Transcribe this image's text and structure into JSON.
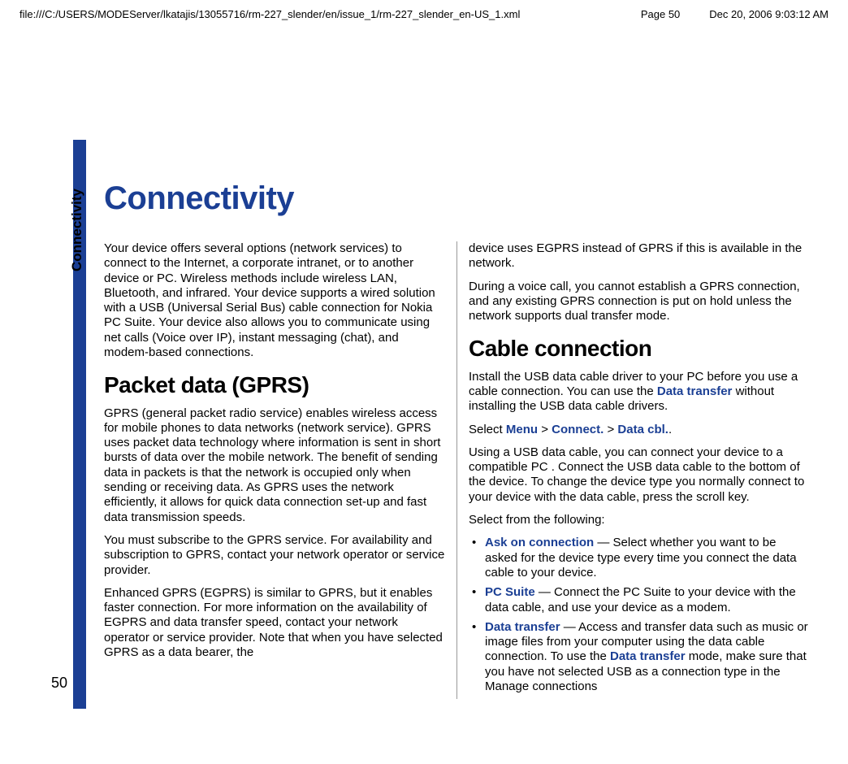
{
  "header": {
    "path": "file:///C:/USERS/MODEServer/lkatajis/13055716/rm-227_slender/en/issue_1/rm-227_slender_en-US_1.xml",
    "page_label": "Page 50",
    "datetime": "Dec 20, 2006 9:03:12 AM"
  },
  "side_tab": "Connectivity",
  "page_number": "50",
  "title": "Connectivity",
  "left": {
    "intro": "Your device offers several options (network services) to connect to the Internet, a corporate intranet, or to another device or PC. Wireless methods include wireless LAN, Bluetooth, and infrared. Your device supports a wired solution with a USB (Universal Serial Bus) cable connection for Nokia PC Suite. Your device also allows you to communicate using net calls (Voice over IP), instant messaging (chat), and modem-based connections.",
    "h2": "Packet data (GPRS)",
    "p1": "GPRS (general packet radio service) enables wireless access for mobile phones to data networks (network service). GPRS uses packet data technology where information is sent in short bursts of data over the mobile network. The benefit of sending data in packets is that the network is occupied only when sending or receiving data. As GPRS uses the network efficiently, it allows for quick data connection set-up and fast data transmission speeds.",
    "p2": "You must subscribe to the GPRS service. For availability and subscription to GPRS, contact your network operator or service provider.",
    "p3": "Enhanced GPRS (EGPRS) is similar to GPRS, but it enables faster connection. For more information on the availability of EGPRS and data transfer speed, contact your network operator or service provider. Note that when you have selected GPRS as a data bearer, the"
  },
  "right": {
    "p1": "device uses EGPRS instead of GPRS if this is available in the network.",
    "p2": "During a voice call, you cannot establish a GPRS connection, and any existing GPRS connection is put on hold unless the network supports dual transfer mode.",
    "h2": "Cable connection",
    "p3a": "Install the USB data cable driver to your PC before you use a cable connection. You can use the ",
    "p3_link": "Data transfer",
    "p3b": " without installing the USB data cable drivers.",
    "select_prefix": "Select ",
    "menu": "Menu",
    "gt1": " > ",
    "connect": "Connect.",
    "gt2": " > ",
    "datacbl": "Data cbl.",
    "select_suffix": ".",
    "p5": "Using a USB data cable, you can connect your device to a compatible PC . Connect the USB data cable to the bottom of the device. To change the device type you normally connect to your device with the data cable, press the scroll key.",
    "p6": "Select from the following:",
    "b1_link": "Ask on connection",
    "b1_rest": " — Select whether you want to be asked for the device type every time you connect the data cable to your device.",
    "b2_link": "PC Suite",
    "b2_rest": " — Connect the PC Suite to your device with the data cable, and use your device as a modem.",
    "b3_link": "Data transfer",
    "b3_rest_a": " — Access and transfer data such as music or image files from your computer using the data cable connection. To use the ",
    "b3_link2": "Data transfer",
    "b3_rest_b": " mode, make sure that you have not selected USB as a connection type in the Manage connections"
  }
}
